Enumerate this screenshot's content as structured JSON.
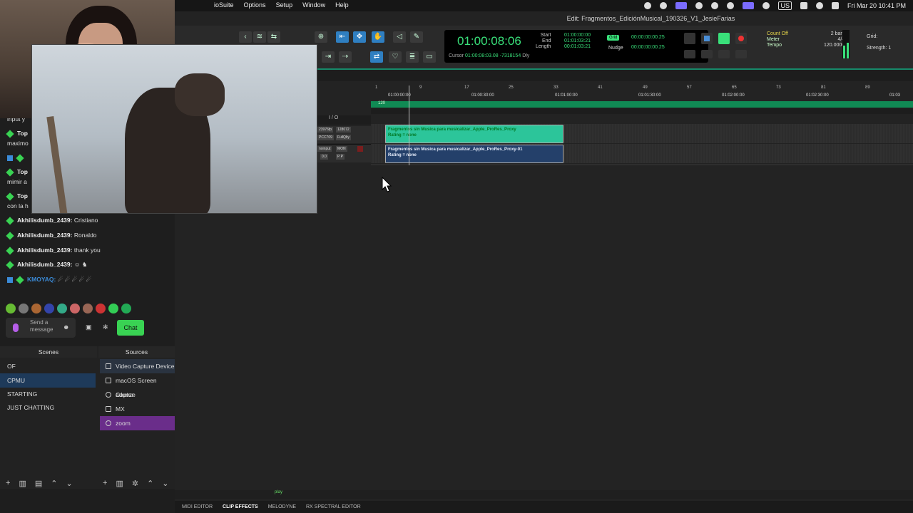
{
  "menubar": {
    "app_fragment": "ioSuite",
    "menus": [
      "Options",
      "Setup",
      "Window",
      "Help"
    ],
    "keyboard": "US",
    "datetime": "Fri Mar 20  10:41 PM"
  },
  "protools": {
    "title": "Edit: Fragmentos_EdiciónMusical_190326_V1_JesieFarias",
    "main_counter": "01:00:08:06",
    "sel_labels": [
      "Start",
      "End",
      "Length"
    ],
    "sel_values": [
      "01:00:00:00",
      "01:01:03:21",
      "00:01:03:21"
    ],
    "cursor_label": "Cursor",
    "cursor_value": "01:00:08:03.08",
    "cursor_sample": "-7318154",
    "dly_label": "Dly",
    "grid_label": "Grid",
    "nudge_label": "Nudge",
    "grid_value": "00:00:00:00.25",
    "nudge_value": "00:00:00:00.25",
    "count_off": "Count Off",
    "meter_label": "Meter",
    "tempo_label": "Tempo",
    "count_off_value": "2 bars",
    "meter_value": "4/4",
    "tempo_value": "120.0000",
    "grid_lbl2": "Grid:",
    "strength_lbl": "Strength:",
    "strength_value": "1",
    "bar_ticks": [
      "1",
      "9",
      "17",
      "25",
      "33",
      "41",
      "49",
      "57",
      "65",
      "73",
      "81",
      "89"
    ],
    "tc_ticks": [
      "01:00:00:00",
      "01:00:30:00",
      "01:01:00:00",
      "01:01:30:00",
      "01:02:00:00",
      "01:02:30:00",
      "01:03"
    ],
    "tempo_marker": "120",
    "io_header": "I / O",
    "track1_chips": [
      "23976fp",
      "128072",
      "PCC709",
      "FullQlty"
    ],
    "track2_chips": [
      "noinput",
      "MON"
    ],
    "track2_vol": "0.0",
    "track2_pan": "P  P",
    "clip_video_title": "Fragmentos sin Musica para musicalizar_Apple_ProRes_Proxy",
    "clip_video_rating": "Rating = none",
    "clip_audio_title": "Fragmentos sin Musica para musicalizar_Apple_ProRes_Proxy-01",
    "clip_audio_rating": "Rating = none",
    "status_text": "play",
    "tabs": [
      "MIDI EDITOR",
      "CLIP EFFECTS",
      "MELODYNE",
      "RX SPECTRAL EDITOR"
    ]
  },
  "chat": {
    "partial_lines": [
      {
        "user": "",
        "text": "input y"
      },
      {
        "user": "Top",
        "text": ""
      },
      {
        "user": "",
        "text": "maximo"
      },
      {
        "user": "Top",
        "text": ""
      },
      {
        "user": "",
        "text": "mimir a"
      },
      {
        "user": "Top",
        "text": ""
      },
      {
        "user": "",
        "text": "con la h"
      }
    ],
    "lines": [
      {
        "user": "Akhilisdumb_2439:",
        "text": "Cristiano"
      },
      {
        "user": "Akhilisdumb_2439:",
        "text": "Ronaldo"
      },
      {
        "user": "Akhilisdumb_2439:",
        "text": "thank you"
      },
      {
        "user": "Akhilisdumb_2439:",
        "text": ""
      },
      {
        "user": "KMOYAQ:",
        "text": ""
      }
    ],
    "input_placeholder": "Send a message",
    "chat_button": "Chat",
    "user_color_kmoyaq": "#3b8bd8"
  },
  "obs": {
    "scenes_title": "Scenes",
    "sources_title": "Sources",
    "scenes": [
      "OF",
      "CPMU",
      "STARTING",
      "JUST CHATTING"
    ],
    "selected_scene": "CPMU",
    "sources": [
      "Video Capture Device",
      "macOS Screen Captur",
      "adueze",
      "MX",
      "zoom"
    ]
  }
}
